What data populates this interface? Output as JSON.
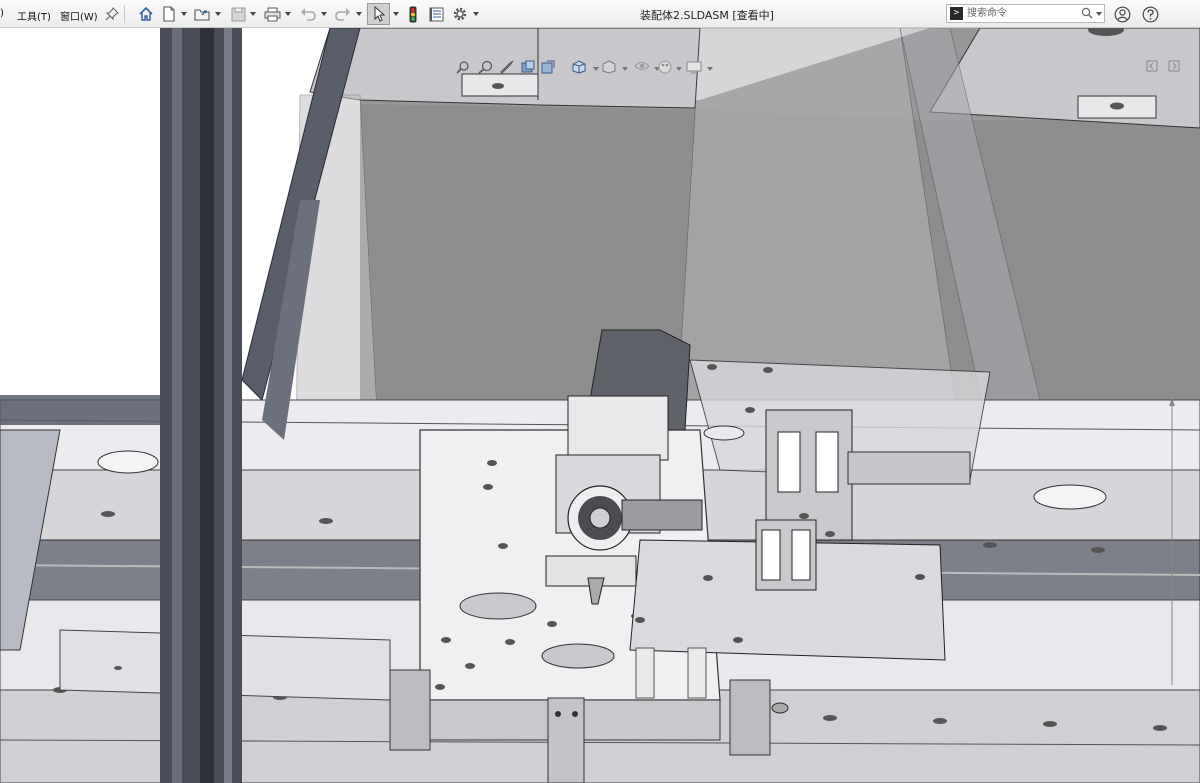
{
  "menu": {
    "items": [
      {
        "label": ")"
      },
      {
        "label": "工具(T)"
      },
      {
        "label": "窗口(W)"
      }
    ],
    "pin_icon": "pin-icon"
  },
  "toolbar": {
    "icons": [
      "home-icon",
      "new-document-icon",
      "open-folder-icon",
      "save-icon",
      "print-icon",
      "undo-icon",
      "redo-icon",
      "select-pointer-icon",
      "rebuild-traffic-light-icon",
      "file-properties-icon",
      "options-gear-icon"
    ],
    "active_tool": "select-pointer-icon"
  },
  "document": {
    "title": "装配体2.SLDASM [查看中]"
  },
  "search": {
    "placeholder": "搜索命令"
  },
  "header_right": {
    "icons": [
      "user-account-icon",
      "help-icon"
    ]
  },
  "heads_up_toolbar": {
    "icons": [
      "zoom-to-fit-icon",
      "zoom-to-area-icon",
      "previous-view-icon",
      "section-view-icon",
      "dynamic-annotation-view-icon",
      "view-orientation-icon",
      "display-style-icon",
      "hide-show-items-icon",
      "edit-appearance-icon",
      "apply-scene-icon",
      "view-settings-icon"
    ]
  },
  "viewport": {
    "background_color": "#ffffff",
    "rear_panel_color": "#8e8e8e",
    "frame_color": "#4a4d57",
    "plate_color": "#ececf0",
    "transparent_guard_color": "#b5b3b8"
  },
  "panel_controls": {
    "icons": [
      "collapse-panel-icon",
      "expand-panel-icon"
    ]
  }
}
